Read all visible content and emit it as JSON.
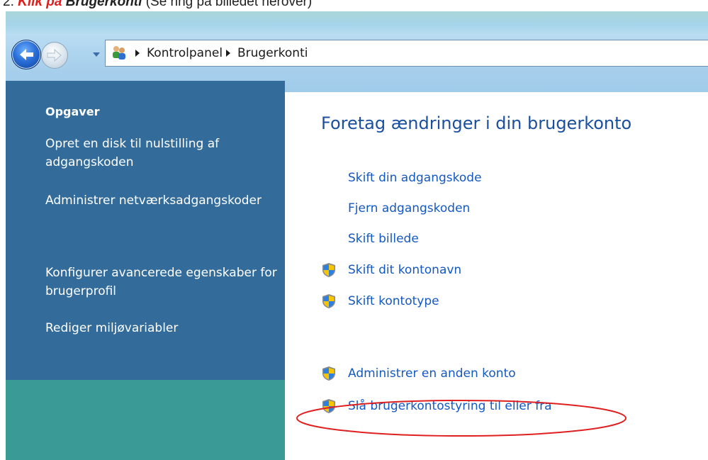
{
  "caption": {
    "step": "2.",
    "action": "Klik på",
    "target": "Brugerkonti",
    "note": "(Se ring på billedet herover)"
  },
  "breadcrumb": {
    "items": [
      "Kontrolpanel",
      "Brugerkonti"
    ]
  },
  "sidebar": {
    "heading": "Opgaver",
    "links": [
      "Opret en disk til nulstilling af adgangskoden",
      "Administrer netværksadgangskoder",
      "Konfigurer avancerede egenskaber for brugerprofil",
      "Rediger miljøvariabler"
    ]
  },
  "main": {
    "title": "Foretag ændringer i din brugerkonto",
    "tasks": [
      {
        "label": "Skift din adgangskode",
        "icon": "none"
      },
      {
        "label": "Fjern adgangskoden",
        "icon": "none"
      },
      {
        "label": "Skift billede",
        "icon": "none"
      },
      {
        "label": "Skift dit kontonavn",
        "icon": "uac-shield-icon"
      },
      {
        "label": "Skift kontotype",
        "icon": "uac-shield-icon"
      },
      {
        "label": "Administrer en anden konto",
        "icon": "uac-shield-icon"
      },
      {
        "label": "Slå brugerkontostyring til eller fra",
        "icon": "uac-shield-icon",
        "highlighted": true
      }
    ]
  },
  "colors": {
    "sidebar": "#336c9a",
    "sidebar_lower": "#3a9b96",
    "link": "#1458c2",
    "title": "#1b4f9e",
    "highlight_ring": "#e02020"
  }
}
